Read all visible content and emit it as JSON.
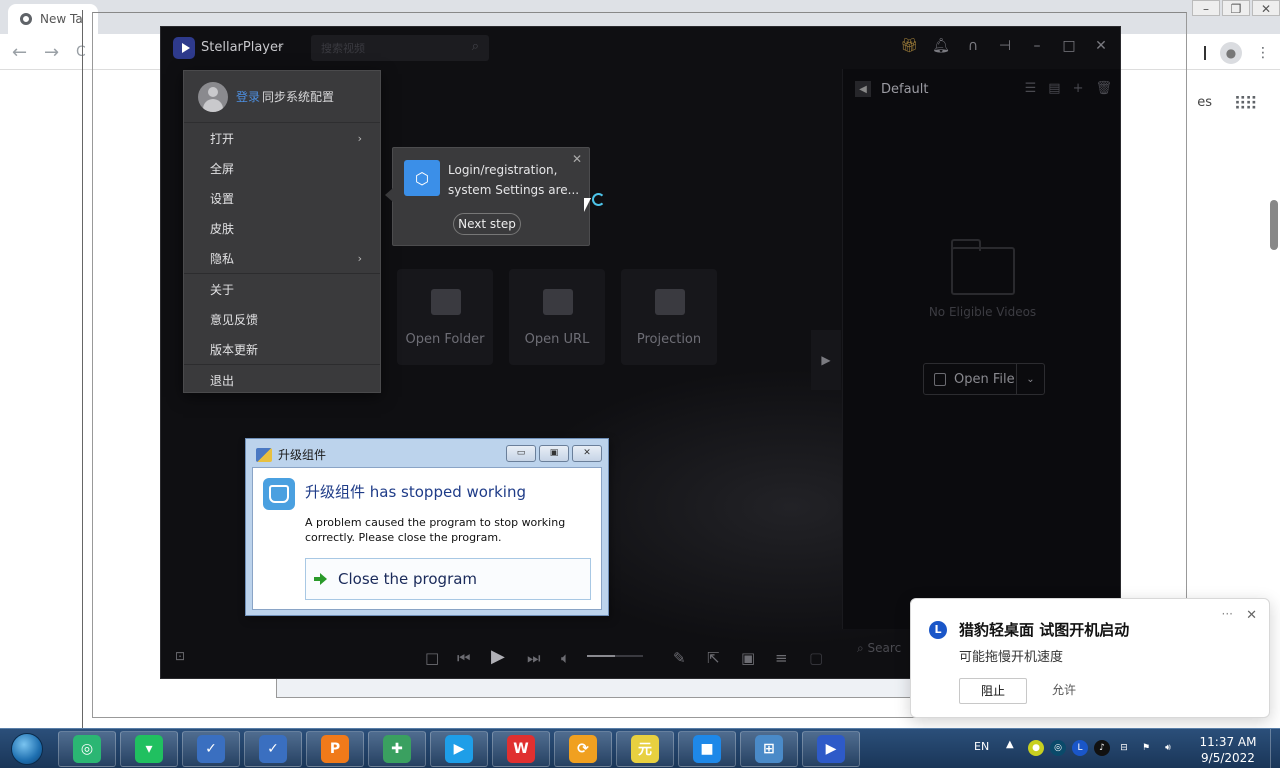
{
  "browser": {
    "tab_title": "New Ta",
    "right_text": "es"
  },
  "player": {
    "app_name": "StellarPlayer",
    "search_placeholder": "搜索视频",
    "tiles": [
      {
        "label": "Open Folder",
        "icon": "folder-icon"
      },
      {
        "label": "Open URL",
        "icon": "link-icon"
      },
      {
        "label": "Projection",
        "icon": "projection-icon"
      }
    ],
    "playlist": {
      "title": "Default",
      "empty_text": "No Eligible Videos",
      "open_file": "Open File",
      "search_placeholder": "Searc"
    }
  },
  "menu": {
    "login": "登录",
    "sync": "同步系统配置",
    "items": [
      {
        "label": "打开",
        "submenu": true
      },
      {
        "label": "全屏",
        "submenu": false
      },
      {
        "label": "设置",
        "submenu": false
      },
      {
        "label": "皮肤",
        "submenu": false
      },
      {
        "label": "隐私",
        "submenu": true
      },
      {
        "label": "关于",
        "submenu": false
      },
      {
        "label": "意见反馈",
        "submenu": false
      },
      {
        "label": "版本更新",
        "submenu": false
      },
      {
        "label": "退出",
        "submenu": false
      }
    ]
  },
  "tooltip": {
    "text": "Login/registration, system Settings are...",
    "next": "Next step"
  },
  "dialog": {
    "title": "升级组件",
    "heading": "升级组件 has stopped working",
    "message": "A problem caused the program to stop working correctly. Please close the program.",
    "close_label": "Close the program"
  },
  "toast": {
    "title": "猎豹轻桌面 试图开机启动",
    "subtitle": "可能拖慢开机速度",
    "block": "阻止",
    "allow": "允许"
  },
  "taskbar": {
    "apps": [
      {
        "name": "360-security",
        "color": "#2bb673",
        "glyph": "◎"
      },
      {
        "name": "wechat-work",
        "color": "#20c060",
        "glyph": "▾"
      },
      {
        "name": "checklist-app",
        "color": "#3a6fc0",
        "glyph": "✓"
      },
      {
        "name": "checklist-app-2",
        "color": "#3a6fc0",
        "glyph": "✓"
      },
      {
        "name": "wps-presentation",
        "color": "#f07a1a",
        "glyph": "P"
      },
      {
        "name": "map-app",
        "color": "#3aa060",
        "glyph": "✚"
      },
      {
        "name": "video-player",
        "color": "#1e9ee8",
        "glyph": "▶"
      },
      {
        "name": "wps-office",
        "color": "#e03030",
        "glyph": "W"
      },
      {
        "name": "sync-app",
        "color": "#f0a020",
        "glyph": "⟳"
      },
      {
        "name": "yuanqi-app",
        "color": "#e8d040",
        "glyph": "元"
      },
      {
        "name": "video-camera",
        "color": "#1e88e8",
        "glyph": "■"
      },
      {
        "name": "network-app",
        "color": "#4a8ac8",
        "glyph": "⊞"
      },
      {
        "name": "stellar-player",
        "color": "#2e5ac8",
        "glyph": "▶"
      }
    ],
    "lang": "EN",
    "time": "11:37 AM",
    "date": "9/5/2022"
  }
}
